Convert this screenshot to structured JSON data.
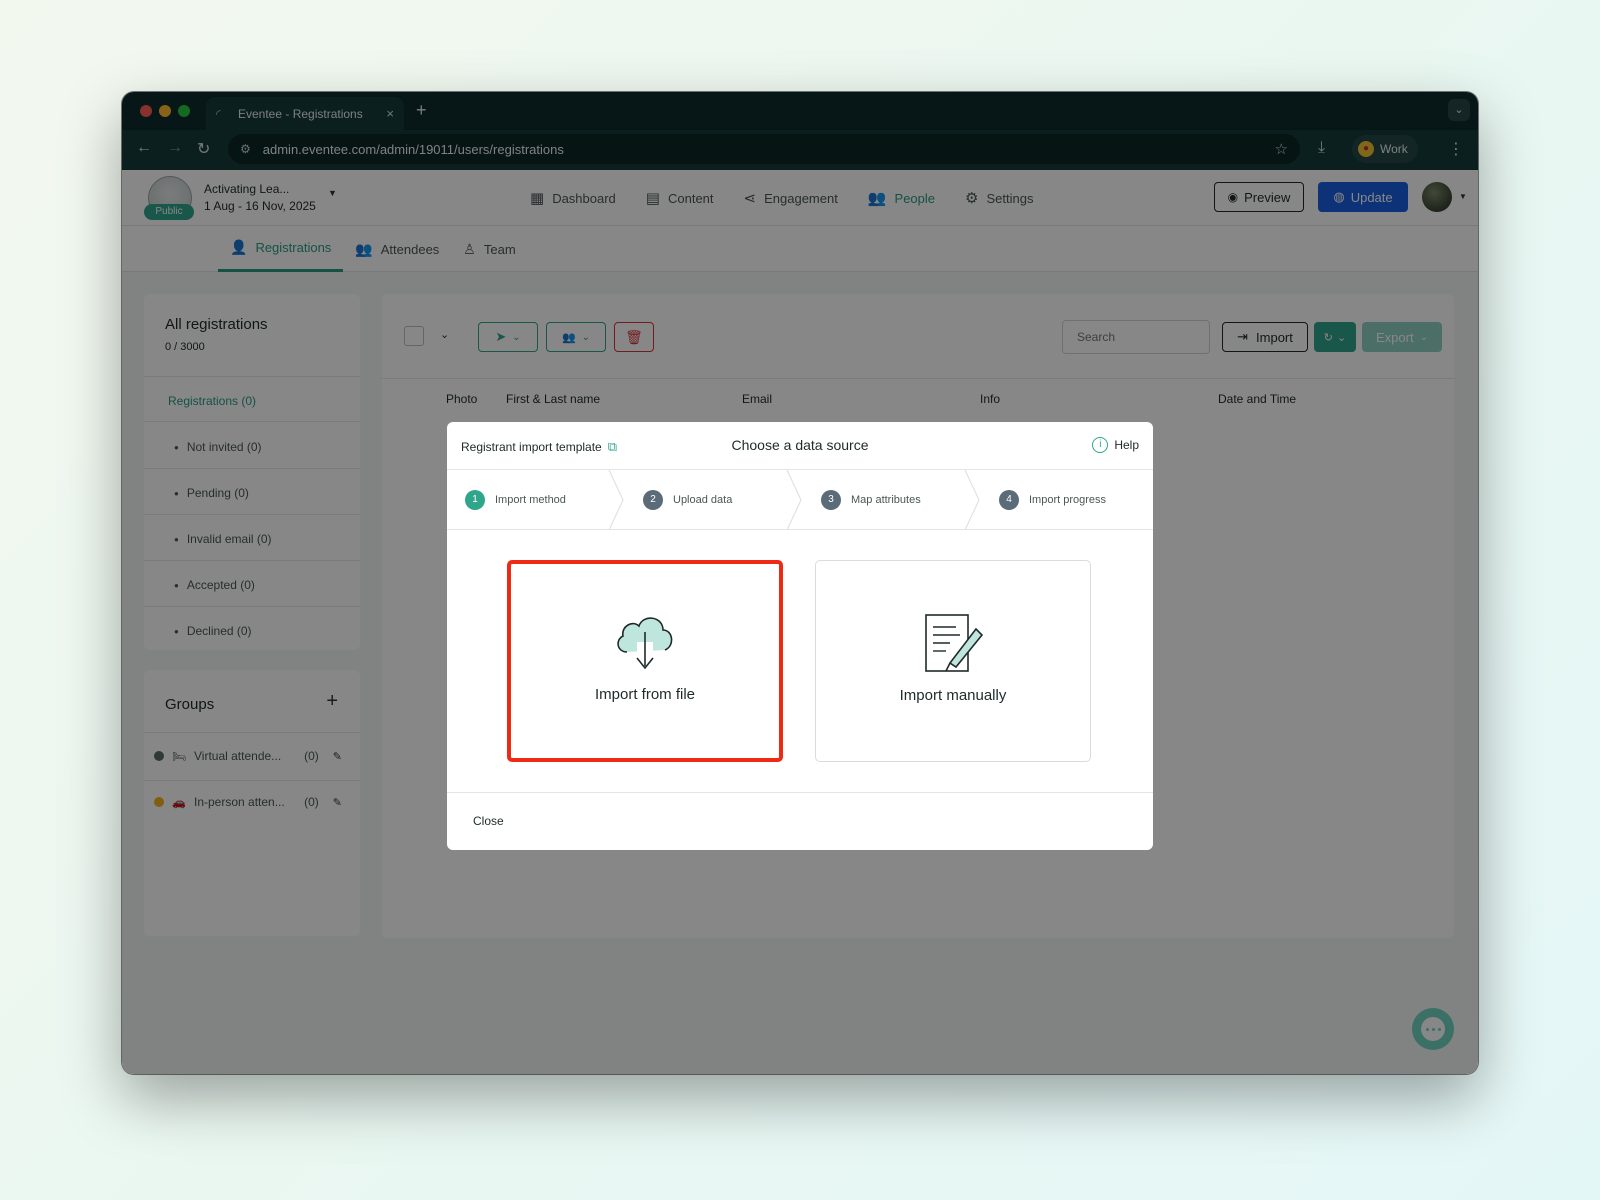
{
  "browser": {
    "tab_title": "Eventee - Registrations",
    "tab_close": "×",
    "new_tab": "+",
    "url": "admin.eventee.com/admin/19011/users/registrations",
    "profile_name": "Work"
  },
  "header": {
    "event_name": "Activating Lea...",
    "event_dates": "1 Aug - 16 Nov, 2025",
    "public_badge": "Public",
    "nav": [
      {
        "label": "Dashboard",
        "icon": "dashboard-icon"
      },
      {
        "label": "Content",
        "icon": "calendar-icon"
      },
      {
        "label": "Engagement",
        "icon": "share-icon"
      },
      {
        "label": "People",
        "icon": "people-icon",
        "active": true
      },
      {
        "label": "Settings",
        "icon": "gear-icon"
      }
    ],
    "preview_label": "Preview",
    "update_label": "Update"
  },
  "subnav": {
    "tabs": [
      {
        "label": "Registrations",
        "active": true
      },
      {
        "label": "Attendees"
      },
      {
        "label": "Team"
      }
    ]
  },
  "sidebar": {
    "all_title": "All registrations",
    "all_count": "0 / 3000",
    "registrations": "Registrations (0)",
    "items": [
      "Not invited (0)",
      "Pending (0)",
      "Invalid email (0)",
      "Accepted (0)",
      "Declined (0)"
    ],
    "groups_title": "Groups",
    "groups_add": "+",
    "groups": [
      {
        "name": "Virtual attende...",
        "count": "(0)",
        "color": "#5b6b6a",
        "emoji": "🛏"
      },
      {
        "name": "In-person atten...",
        "count": "(0)",
        "color": "#f2b01e",
        "emoji": "🚗"
      }
    ]
  },
  "toolbar": {
    "search_placeholder": "Search",
    "import_label": "Import",
    "export_label": "Export"
  },
  "table": {
    "columns": [
      "Photo",
      "First & Last name",
      "Email",
      "Info",
      "Date and Time"
    ]
  },
  "modal": {
    "template_link": "Registrant import template",
    "title": "Choose a data source",
    "help_label": "Help",
    "steps": [
      {
        "num": "1",
        "label": "Import method",
        "active": true
      },
      {
        "num": "2",
        "label": "Upload data"
      },
      {
        "num": "3",
        "label": "Map attributes"
      },
      {
        "num": "4",
        "label": "Import progress"
      }
    ],
    "option_file": "Import from file",
    "option_manual": "Import manually",
    "close_label": "Close"
  },
  "colors": {
    "accent": "#2fa58c",
    "primary_button": "#1a5fe0",
    "selection_highlight": "#ee2a14",
    "danger": "#d9363e"
  }
}
